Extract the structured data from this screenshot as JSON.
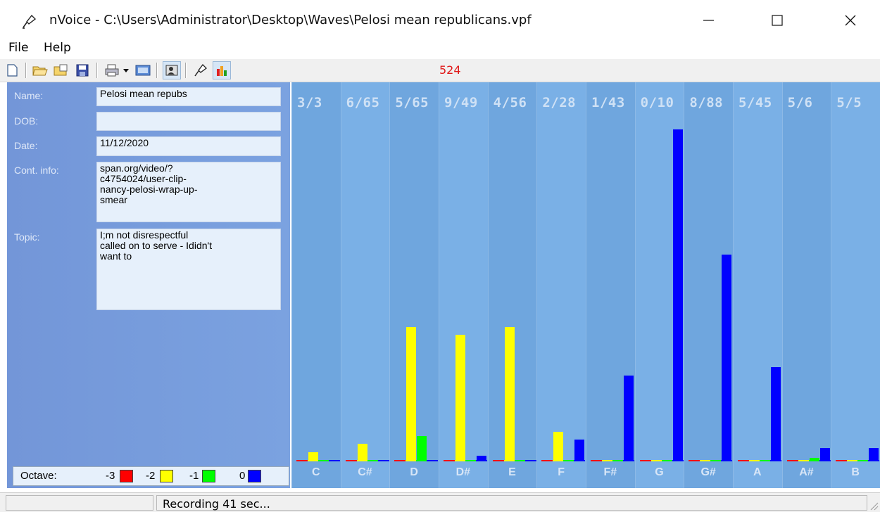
{
  "window": {
    "title": "nVoice - C:\\Users\\Administrator\\Desktop\\Waves\\Pelosi mean republicans.vpf",
    "app_icon": "microphone-icon"
  },
  "menu": [
    "File",
    "Help"
  ],
  "toolbar": {
    "counter": "524",
    "icons": [
      "new-file-icon",
      "open-folder-icon",
      "open-file-icon",
      "save-icon",
      "print-icon",
      "dropdown-arrow-icon",
      "window-icon",
      "person-card-icon",
      "microphone-icon",
      "bar-chart-icon"
    ]
  },
  "form": {
    "name_label": "Name:",
    "name_value": "Pelosi mean repubs",
    "dob_label": "DOB:",
    "dob_value": "",
    "date_label": "Date:",
    "date_value": "11/12/2020",
    "contact_label": "Cont. info:",
    "contact_value": "span.org/video/?\nc4754024/user-clip-\nnancy-pelosi-wrap-up-\nsmear",
    "topic_label": "Topic:",
    "topic_value": "I;m not disrespectful\ncalled on to serve - Ididn't\nwant to"
  },
  "legend": {
    "label": "Octave:",
    "items": [
      {
        "label": "-3",
        "color": "#ff0000"
      },
      {
        "label": "-2",
        "color": "#ffff00"
      },
      {
        "label": "-1",
        "color": "#00ff00"
      },
      {
        "label": "0",
        "color": "#0000ff"
      }
    ]
  },
  "chart_data": {
    "type": "bar",
    "categories": [
      "C",
      "C#",
      "D",
      "D#",
      "E",
      "F",
      "F#",
      "G",
      "G#",
      "A",
      "A#",
      "B"
    ],
    "top_labels": [
      "3/3",
      "6/65",
      "5/65",
      "9/49",
      "4/56",
      "2/28",
      "1/43",
      "0/10",
      "8/88",
      "5/45",
      "5/6",
      "5/5"
    ],
    "series": [
      {
        "name": "-3",
        "color": "#ff0000",
        "values": [
          0,
          0,
          0,
          0,
          0,
          0,
          0,
          0,
          0,
          0,
          0,
          0
        ]
      },
      {
        "name": "-2",
        "color": "#ffff00",
        "values": [
          2,
          4,
          33,
          31,
          33,
          7,
          0,
          0,
          0,
          0,
          0,
          0
        ]
      },
      {
        "name": "-1",
        "color": "#00ff00",
        "values": [
          0,
          0,
          6,
          0,
          0,
          0,
          0,
          0,
          0,
          0,
          0.5,
          0
        ]
      },
      {
        "name": "0",
        "color": "#0000ff",
        "values": [
          0,
          0,
          0,
          1,
          0,
          5,
          21,
          82,
          51,
          23,
          3,
          3
        ]
      }
    ],
    "ylim": [
      0,
      85
    ]
  },
  "status": {
    "text": "Recording 41 sec..."
  }
}
